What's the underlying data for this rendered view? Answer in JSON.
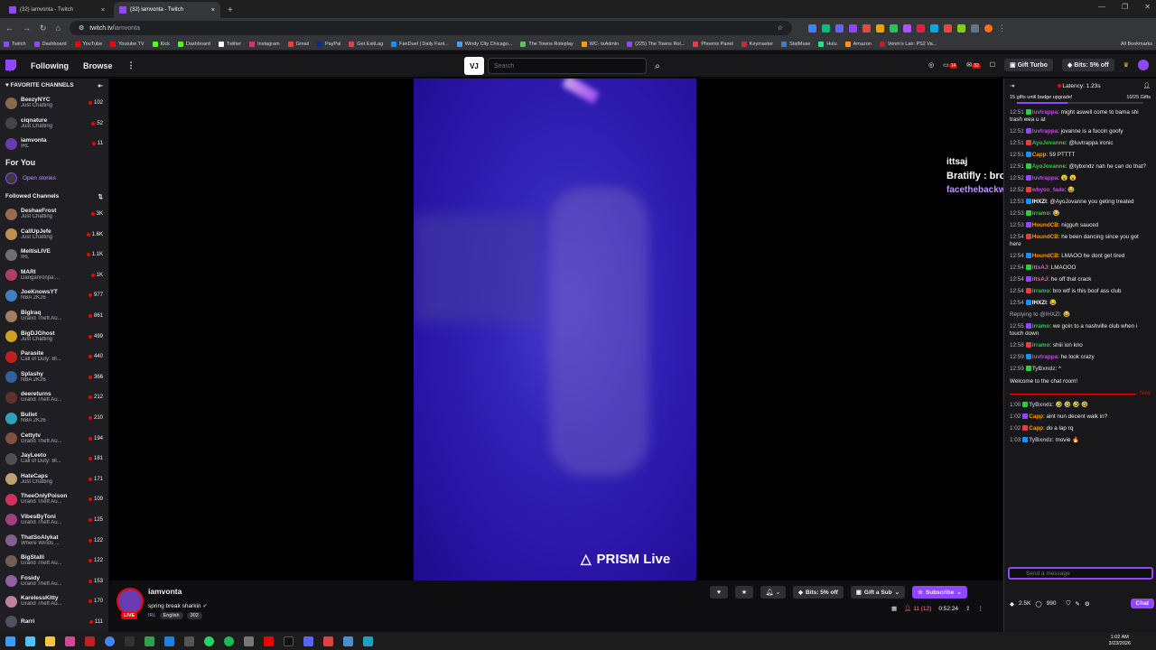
{
  "browser": {
    "tabs": [
      {
        "title": "(32) iamvonta - Twitch",
        "active": false
      },
      {
        "title": "(32) iamvonta - Twitch",
        "active": true
      }
    ],
    "url_host": "twitch.tv/",
    "url_path": "iamvonta",
    "bookmarks": [
      "Twitch",
      "Dashboard",
      "YouTube",
      "Youtube TV",
      "Kick",
      "Dashboard",
      "Twitter",
      "Instagram",
      "Gmail",
      "PayPal",
      "Get ExitLag",
      "FanDuel | Daily Fant...",
      "Windy City Chicago...",
      "The Towns Roleplay",
      "WC- txAdmin",
      "(225) The Towns Rol...",
      "Phoenix Panel",
      "Keymaster",
      "StatMuse",
      "Hulu",
      "Amazon",
      "Venm's Lair: PS2 Va..."
    ],
    "all_bookmarks": "All Bookmarks"
  },
  "topnav": {
    "following": "Following",
    "browse": "Browse",
    "vj": "VJ",
    "search_placeholder": "Search",
    "notif_count_1": "14",
    "notif_count_2": "32",
    "gift_turbo": "Gift Turbo",
    "bits": "Bits: 5% off"
  },
  "sidebar": {
    "favorites_title": "FAVORITE CHANNELS",
    "favorites": [
      {
        "name": "BeezyNYC",
        "game": "Just Chatting",
        "viewers": "102",
        "color": "#8a6a4a"
      },
      {
        "name": "ciqnature",
        "game": "Just Chatting",
        "viewers": "52",
        "color": "#444"
      },
      {
        "name": "iamvonta",
        "game": "IRL",
        "viewers": "11",
        "color": "#6a3ab0"
      }
    ],
    "for_you": "For You",
    "open_stories": "Open stories",
    "followed_title": "Followed Channels",
    "followed": [
      {
        "name": "DeshaeFrost",
        "game": "Just Chatting",
        "viewers": "3K",
        "color": "#9a6a50"
      },
      {
        "name": "CallUpJefe",
        "game": "Just Chatting",
        "viewers": "1.6K",
        "color": "#c09050"
      },
      {
        "name": "MeltisLIVE",
        "game": "IRL",
        "viewers": "1.1K",
        "color": "#707070"
      },
      {
        "name": "MARI",
        "game": "Danganronpa:...",
        "viewers": "1K",
        "color": "#b04060"
      },
      {
        "name": "JoeKnowsYT",
        "game": "NBA 2K26",
        "viewers": "977",
        "color": "#4080c0"
      },
      {
        "name": "BigIraq",
        "game": "Grand Theft Au...",
        "viewers": "861",
        "color": "#a08060"
      },
      {
        "name": "BigDJGhost",
        "game": "Just Chatting",
        "viewers": "499",
        "color": "#d0a020"
      },
      {
        "name": "Parasite",
        "game": "Call of Duty: Bl...",
        "viewers": "440",
        "color": "#c02020"
      },
      {
        "name": "Splashy",
        "game": "NBA 2K26",
        "viewers": "366",
        "color": "#3060a0"
      },
      {
        "name": "deereturns",
        "game": "Grand Theft Au...",
        "viewers": "212",
        "color": "#603030"
      },
      {
        "name": "Bullet",
        "game": "NBA 2K26",
        "viewers": "210",
        "color": "#30a0c0"
      },
      {
        "name": "Cettytv",
        "game": "Grand Theft Au...",
        "viewers": "194",
        "color": "#805040"
      },
      {
        "name": "JayLeeto",
        "game": "Call of Duty: Bl...",
        "viewers": "181",
        "color": "#505050"
      },
      {
        "name": "HateCaps",
        "game": "Just Chatting",
        "viewers": "171",
        "color": "#c0a070"
      },
      {
        "name": "TheeOnlyPoison",
        "game": "Grand Theft Au...",
        "viewers": "109",
        "color": "#d03060"
      },
      {
        "name": "VibesByToni",
        "game": "Grand Theft Au...",
        "viewers": "125",
        "color": "#a04080"
      },
      {
        "name": "ThatSoAlykat",
        "game": "Where Winds ...",
        "viewers": "122",
        "color": "#806090"
      },
      {
        "name": "BigStalli",
        "game": "Grand Theft Au...",
        "viewers": "122",
        "color": "#706050"
      },
      {
        "name": "Fosidy",
        "game": "Grand Theft Au...",
        "viewers": "153",
        "color": "#9060a0"
      },
      {
        "name": "KarelessKitty",
        "game": "Grand Theft Au...",
        "viewers": "170",
        "color": "#c080a0"
      },
      {
        "name": "Rarri",
        "game": "",
        "viewers": "111",
        "color": "#505060"
      }
    ]
  },
  "video": {
    "watermark": "PRISM Live",
    "overlay_lines": [
      "ittsaj",
      "Bratifly : bro",
      "facethebackwoods : no"
    ]
  },
  "info": {
    "channel": "iamvonta",
    "live": "LIVE",
    "title": "spring break sharkin",
    "category": "IRL",
    "tag": "English",
    "tag_count": "302",
    "bits": "Bits: 5% off",
    "gift_sub": "Gift a Sub",
    "subscribe": "Subscribe",
    "viewers": "11 (12)",
    "uptime": "0:52:24"
  },
  "chat": {
    "latency": "Latency: 1.23s",
    "gift_text": "15 gifts until badge upgrade!",
    "gift_count": "10/25 Gifts",
    "messages": [
      {
        "t": "12:51",
        "u": "luvtrappa",
        "c": "#c04ce0",
        "m": ": might aswell come to bama shi trash wea u at"
      },
      {
        "t": "12:51",
        "u": "luvtrappa",
        "c": "#c04ce0",
        "m": ": jovanne is a fuccin goofy"
      },
      {
        "t": "12:51",
        "u": "AyoJovanne",
        "c": "#2ecc40",
        "m": ": @luvtrappa ironic"
      },
      {
        "t": "12:51",
        "u": "Capp",
        "c": "#ff9900",
        "m": ": 59 PTTTT"
      },
      {
        "t": "12:51",
        "u": "AyoJovanne",
        "c": "#2ecc40",
        "m": ": @tybxndz nah he can do that?"
      },
      {
        "t": "12:52",
        "u": "luvtrappa",
        "c": "#c04ce0",
        "m": ": 😮 😮"
      },
      {
        "t": "12:52",
        "u": "whyso_fade",
        "c": "#c04ce0",
        "m": ": 😂"
      },
      {
        "t": "12:53",
        "u": "IHXZI",
        "c": "#ffffff",
        "m": ": @AyoJovanne you geting treated"
      },
      {
        "t": "12:53",
        "u": "irramo",
        "c": "#2ecc40",
        "m": ": 😂"
      },
      {
        "t": "12:53",
        "u": "HoundCB",
        "c": "#ff9900",
        "m": ": nigguh sauced"
      },
      {
        "t": "12:54",
        "u": "HoundCB",
        "c": "#ff9900",
        "m": ": he been dancing since you got here"
      },
      {
        "t": "12:54",
        "u": "HoundCB",
        "c": "#ff9900",
        "m": ": LMAOO he dont get tired"
      },
      {
        "t": "12:54",
        "u": "ittsAJ",
        "c": "#e060c0",
        "m": ": LMAOOO"
      },
      {
        "t": "12:54",
        "u": "ittsAJ",
        "c": "#e060c0",
        "m": ": he off that crack"
      },
      {
        "t": "12:54",
        "u": "irramo",
        "c": "#2ecc40",
        "m": ": bro wtf is this boof ass club"
      },
      {
        "t": "12:54",
        "u": "IHXZI",
        "c": "#ffffff",
        "m": ": 😂"
      },
      {
        "t": "",
        "u": "",
        "c": "#adadb8",
        "m": "Replying to @IHXZI: 😂"
      },
      {
        "t": "12:55",
        "u": "irramo",
        "c": "#2ecc40",
        "m": ": we goin to a nashville club when i touch down"
      },
      {
        "t": "12:58",
        "u": "irramo",
        "c": "#2ecc40",
        "m": ": shiii ion kno"
      },
      {
        "t": "12:59",
        "u": "luvtrappa",
        "c": "#c04ce0",
        "m": ": he look crazy"
      },
      {
        "t": "12:59",
        "u": "TyBxndz",
        "c": "#adadb8",
        "m": ": ^"
      }
    ],
    "welcome": "Welcome to the chat room!",
    "new_label": "New",
    "new_messages": [
      {
        "t": "1:00",
        "u": "TyBxndz",
        "c": "#adadb8",
        "m": ": 🤣 🤣 🤣 🤣"
      },
      {
        "t": "1:02",
        "u": "Capp",
        "c": "#ff9900",
        "m": ": aint nun decent walk in?"
      },
      {
        "t": "1:02",
        "u": "Capp",
        "c": "#ff9900",
        "m": ": do a lap rq"
      },
      {
        "t": "1:03",
        "u": "TyBxndz",
        "c": "#adadb8",
        "m": ": movie 🔥"
      }
    ],
    "input_placeholder": "Send a message",
    "points": "2.5K",
    "points2": "990",
    "chat_button": "Chat"
  },
  "taskbar": {
    "time": "1:02 AM",
    "date": "3/23/2026"
  }
}
